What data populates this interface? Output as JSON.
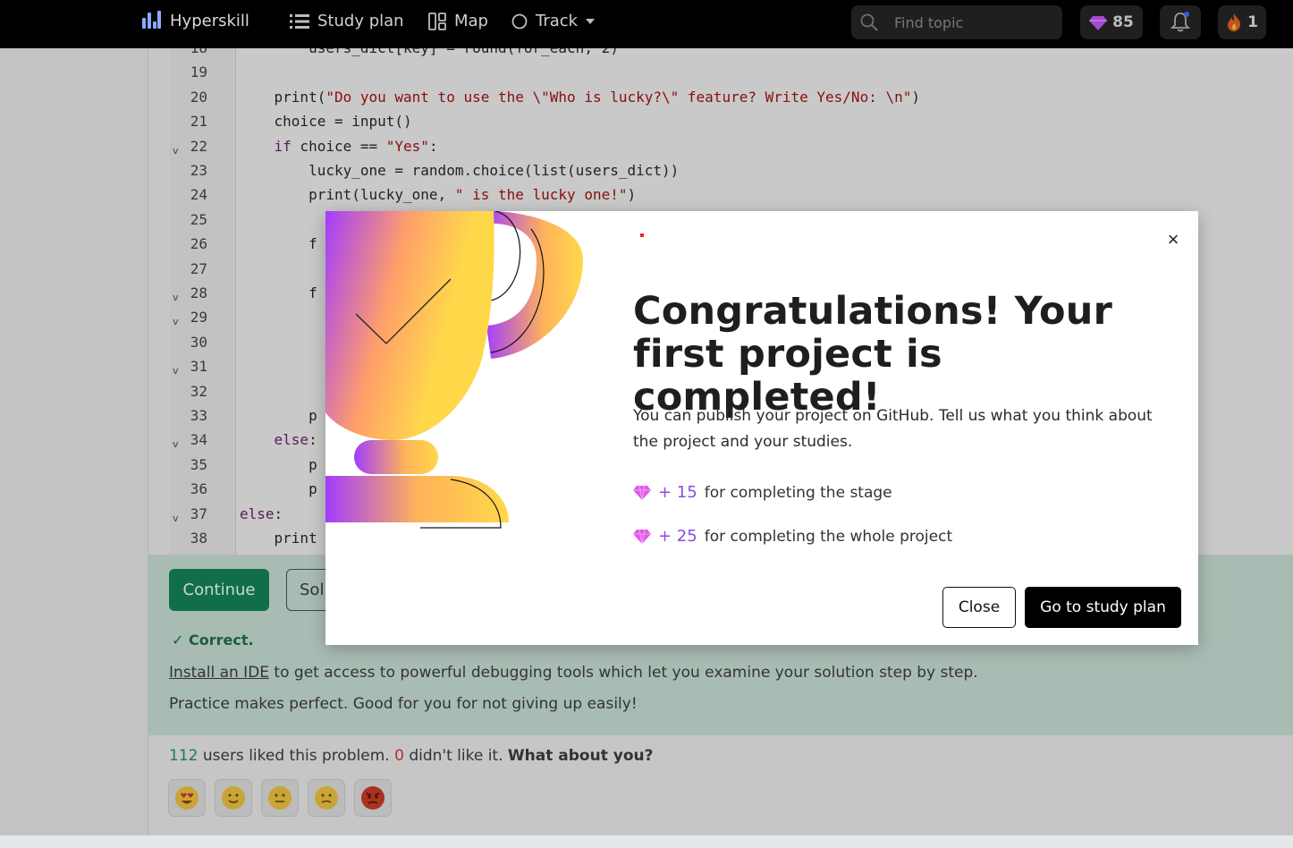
{
  "nav": {
    "brand": "Hyperskill",
    "study_plan": "Study plan",
    "map": "Map",
    "track": "Track",
    "search_placeholder": "Find topic",
    "gems": "85",
    "streak": "1"
  },
  "code": {
    "lines": [
      {
        "n": "18",
        "text": "        users_dict[key] = round(for_each, 2)"
      },
      {
        "n": "19",
        "text": ""
      },
      {
        "n": "20",
        "text": "    print(\"Do you want to use the \\\"Who is lucky?\\\" feature? Write Yes/No: \\n\")"
      },
      {
        "n": "21",
        "text": "    choice = input()"
      },
      {
        "n": "22",
        "text": "    if choice == \"Yes\":"
      },
      {
        "n": "23",
        "text": "        lucky_one = random.choice(list(users_dict))"
      },
      {
        "n": "24",
        "text": "        print(lucky_one, \" is the lucky one!\")"
      },
      {
        "n": "25",
        "text": ""
      },
      {
        "n": "26",
        "text": "        f"
      },
      {
        "n": "27",
        "text": ""
      },
      {
        "n": "28",
        "text": "        f"
      },
      {
        "n": "29",
        "text": ""
      },
      {
        "n": "30",
        "text": ""
      },
      {
        "n": "31",
        "text": ""
      },
      {
        "n": "32",
        "text": ""
      },
      {
        "n": "33",
        "text": "        p"
      },
      {
        "n": "34",
        "text": "    else:"
      },
      {
        "n": "35",
        "text": "        p"
      },
      {
        "n": "36",
        "text": "        p"
      },
      {
        "n": "37",
        "text": "else:"
      },
      {
        "n": "38",
        "text": "    print"
      }
    ]
  },
  "actions": {
    "continue": "Continue",
    "solutions": "Sol"
  },
  "feedback": {
    "correct": "Correct.",
    "install_link": "Install an IDE",
    "install_rest": " to get access to powerful debugging tools which let you examine your solution step by step.",
    "practice": "Practice makes perfect. Good for you for not giving up easily!"
  },
  "likes": {
    "liked_count": "112",
    "liked_text": " users liked this problem. ",
    "disliked_count": "0",
    "disliked_text": " didn't like it. ",
    "question": "What about you?"
  },
  "modal": {
    "title": "Congratulations! Your first project is completed!",
    "body": "You can publish your project on GitHub. Tell us what you think about the project and your studies.",
    "rewards": [
      {
        "amount": "+ 15",
        "text": "for completing the stage"
      },
      {
        "amount": "+ 25",
        "text": "for completing the whole project"
      }
    ],
    "close": "Close",
    "go": "Go to study plan"
  },
  "colors": {
    "accent_green": "#0f9d68",
    "gem_purple": "#8c4be0",
    "trophy_gold": "#ffd84a",
    "trophy_purple": "#a23cff"
  }
}
